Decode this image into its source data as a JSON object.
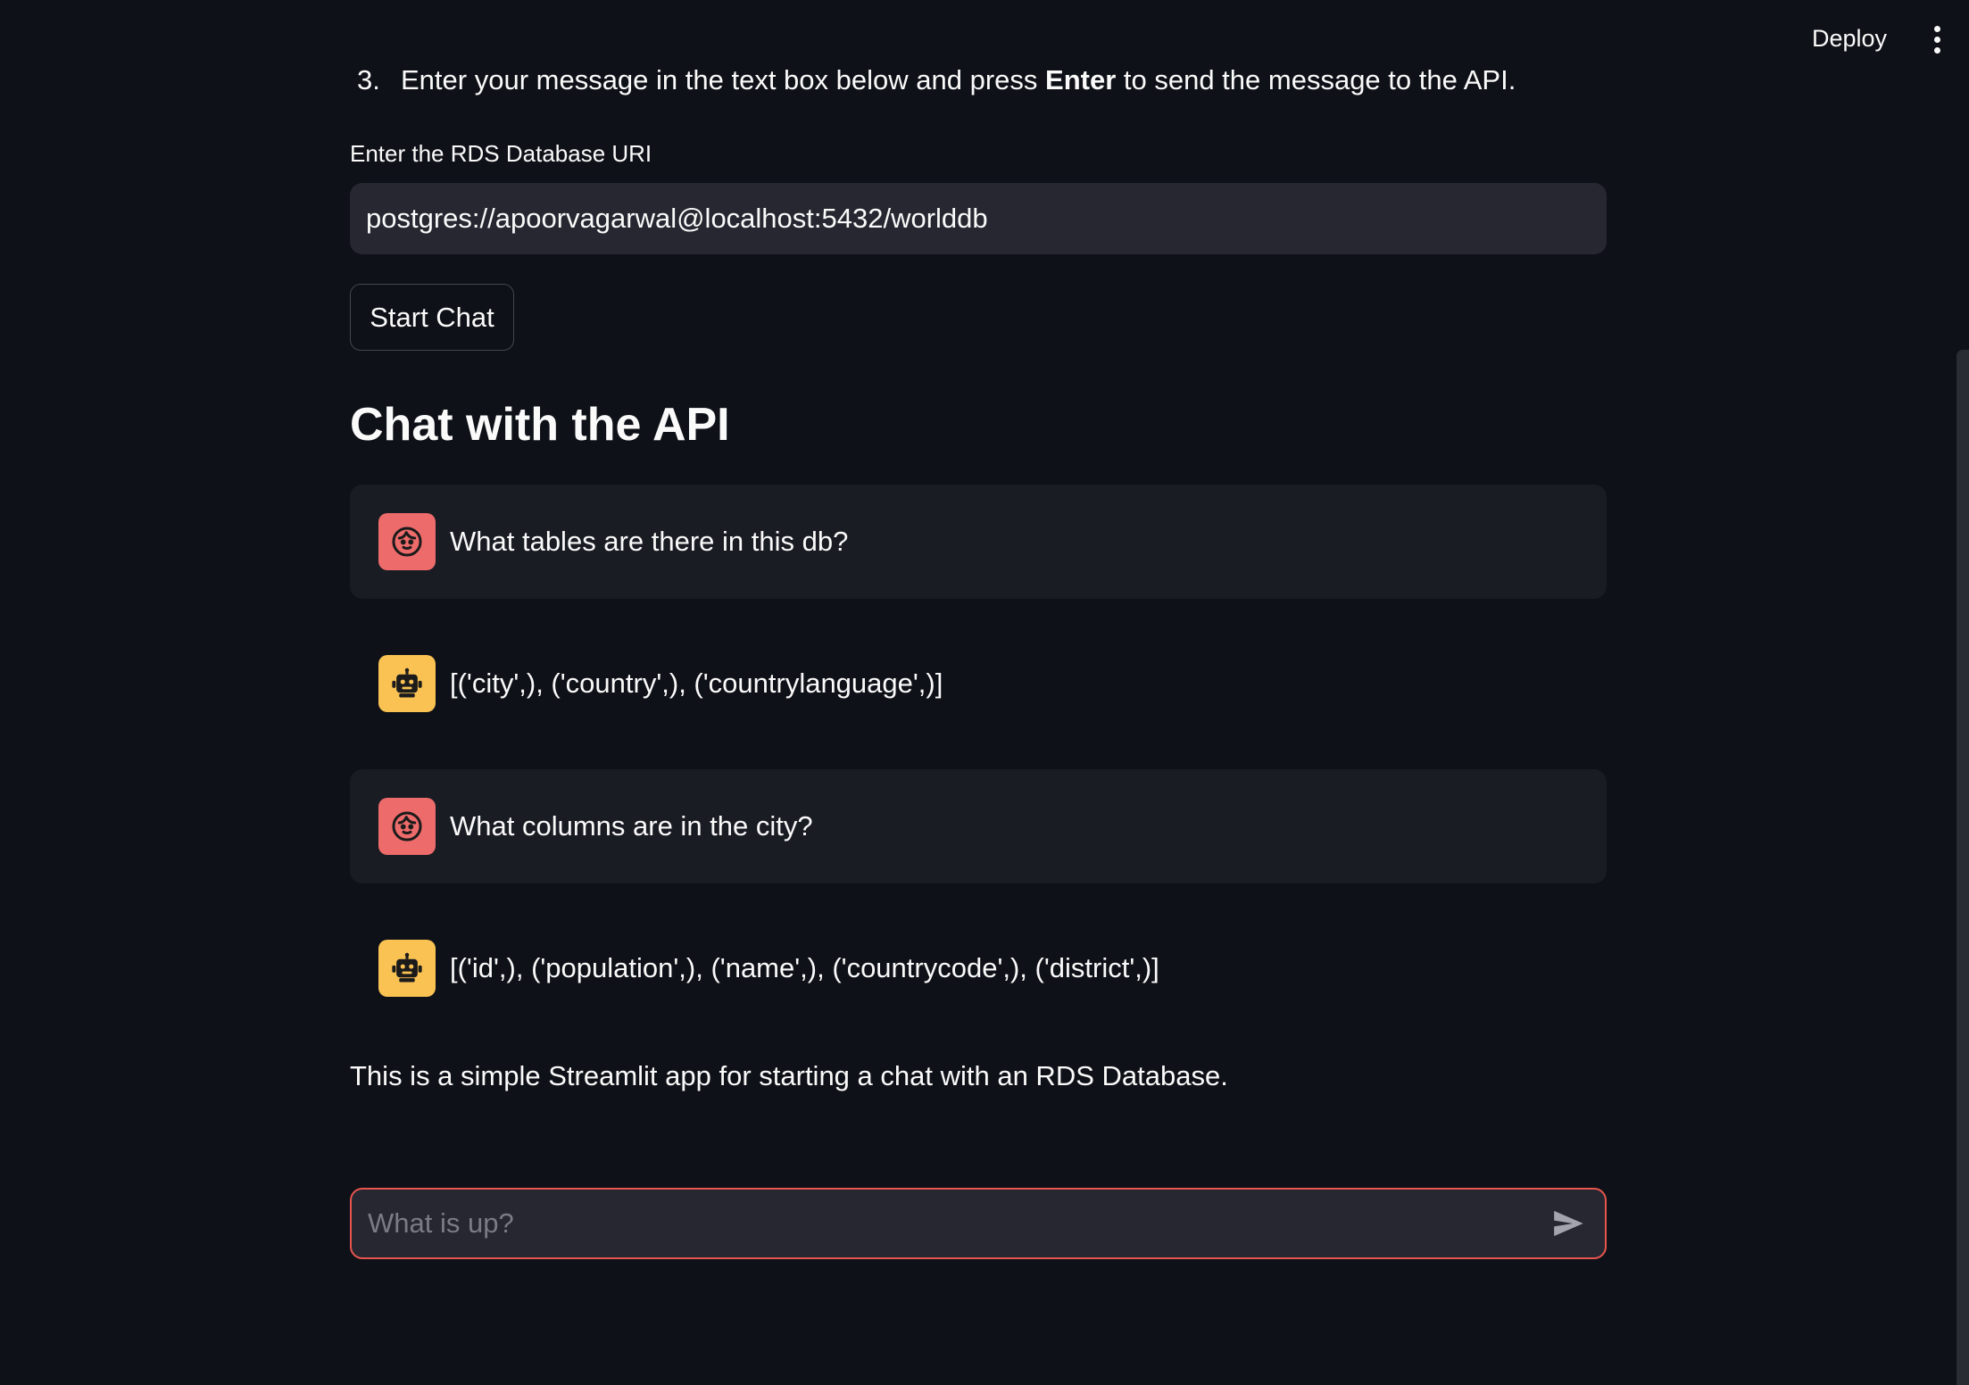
{
  "header": {
    "deploy_label": "Deploy",
    "menu_icon": "kebab-menu-icon"
  },
  "instructions": {
    "step_number": "3.",
    "step_text_before": "Enter your message in the text box below and press ",
    "step_text_bold": "Enter",
    "step_text_after": " to send the message to the API."
  },
  "uri_form": {
    "label": "Enter the RDS Database URI",
    "value": "postgres://apoorvagarwal@localhost:5432/worlddb",
    "button_label": "Start Chat"
  },
  "chat": {
    "title": "Chat with the API",
    "messages": [
      {
        "role": "user",
        "avatar_icon": "user-face-icon",
        "text": "What tables are there in this db?"
      },
      {
        "role": "assistant",
        "avatar_icon": "robot-icon",
        "text": "[('city',), ('country',), ('countrylanguage',)]"
      },
      {
        "role": "user",
        "avatar_icon": "user-face-icon",
        "text": "What columns are in the city?"
      },
      {
        "role": "assistant",
        "avatar_icon": "robot-icon",
        "text": "[('id',), ('population',), ('name',), ('countrycode',), ('district',)]"
      }
    ]
  },
  "footer": {
    "description": "This is a simple Streamlit app for starting a chat with an RDS Database."
  },
  "chat_input": {
    "placeholder": "What is up?",
    "value": "",
    "send_icon": "send-icon"
  },
  "colors": {
    "background": "#0e1117",
    "input_background": "#262730",
    "user_message_background": "#1a1c24",
    "user_avatar": "#ee6b6b",
    "bot_avatar": "#f9c253",
    "focus_border": "#e8554e",
    "text": "#fafafa"
  }
}
